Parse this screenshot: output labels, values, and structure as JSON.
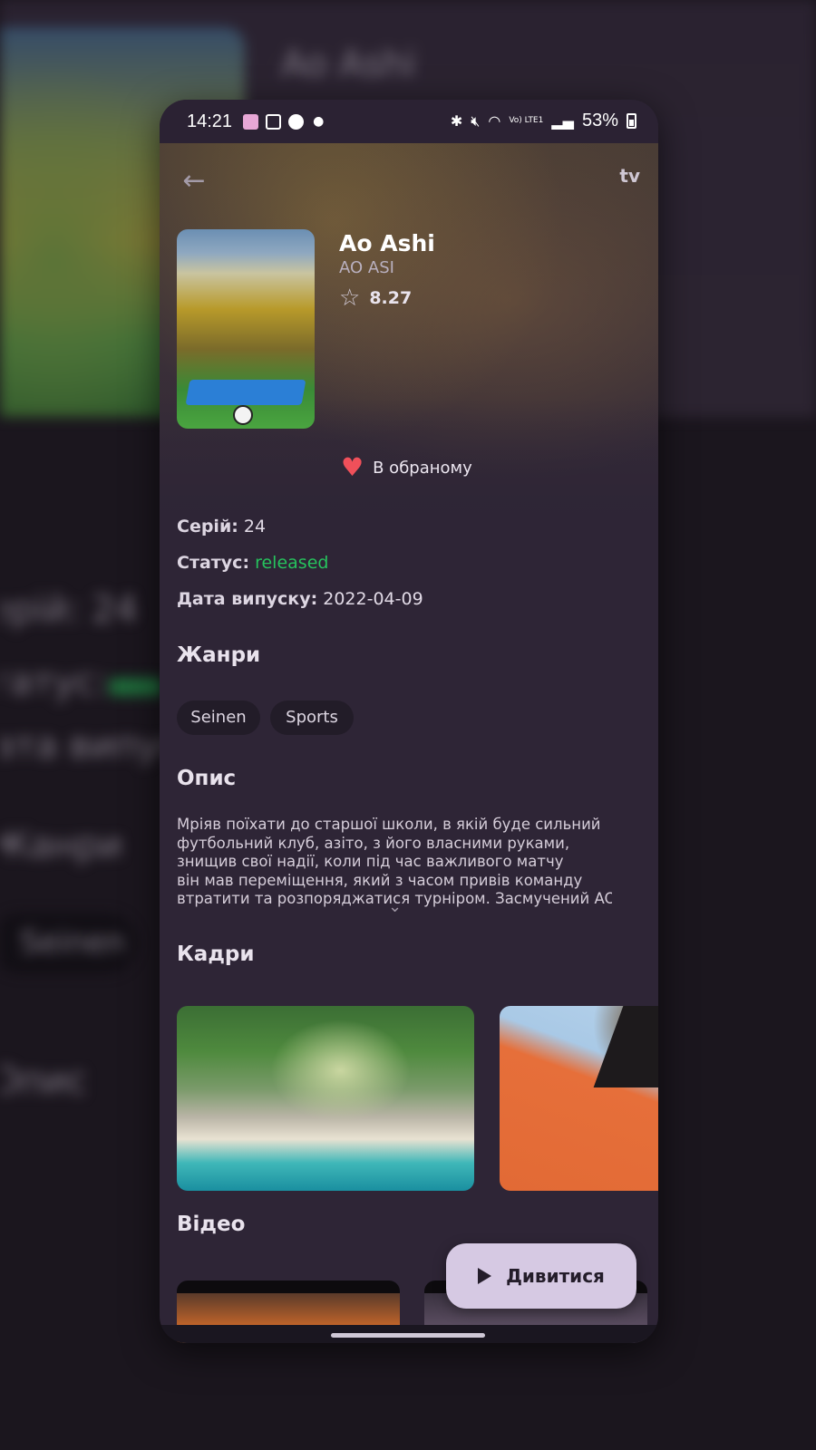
{
  "background": {
    "title": "Ao Ashi",
    "rows": [
      "Серій: 24",
      "Статус:",
      "Дата випус",
      "Жанри",
      "Seinen",
      "Опис"
    ]
  },
  "status_bar": {
    "time": "14:21",
    "battery": "53%",
    "network": "Vo) LTE1"
  },
  "header": {
    "back_icon": "arrow-left-icon",
    "tv_label": "tv"
  },
  "anime": {
    "title": "Ao Ashi",
    "subtitle": "AO ASI",
    "rating": "8.27",
    "favorite_label": "В обраному"
  },
  "info": {
    "episodes_key": "Серій:",
    "episodes_value": "24",
    "status_key": "Статус:",
    "status_value": "released",
    "release_key": "Дата випуску:",
    "release_value": "2022-04-09"
  },
  "genres": {
    "title": "Жанри",
    "items": [
      "Seinen",
      "Sports"
    ]
  },
  "description": {
    "title": "Опис",
    "lines": [
      "Мріяв поїхати до старшої школи, в якій буде сильний",
      "футбольний клуб, азіто, з його власними руками,",
      "знищив свої надії, коли під час важливого матчу",
      "він мав переміщення, який з часом привів команду",
      "втратити та розпоряджатися турніром. Засмучений AOI"
    ]
  },
  "frames": {
    "title": "Кадри"
  },
  "videos": {
    "title": "Відео"
  },
  "watch_button": {
    "label": "Дивитися"
  },
  "colors": {
    "card_bg": "#2e2536",
    "accent_button": "#d6c9e3",
    "status_released": "#26c25d",
    "heart": "#f0505a"
  }
}
